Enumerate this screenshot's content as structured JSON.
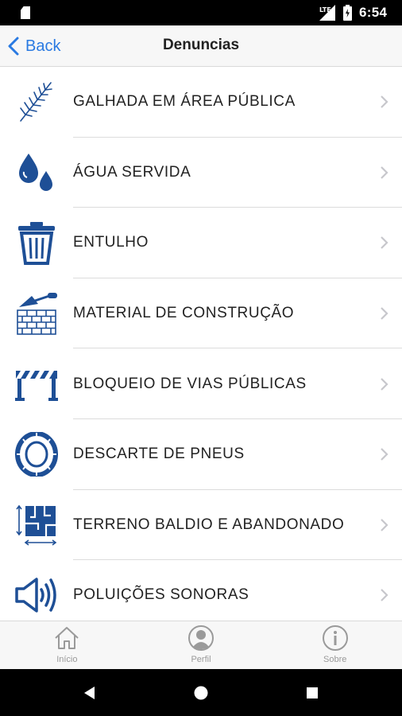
{
  "status_bar": {
    "time": "6:54",
    "network": "LTE"
  },
  "nav": {
    "back_label": "Back",
    "title": "Denuncias"
  },
  "colors": {
    "accent": "#2a7ae2",
    "icon_blue": "#1e4f96",
    "chevron": "#c7c7cc"
  },
  "items": [
    {
      "label": "GALHADA EM ÁREA PÚBLICA",
      "icon": "branch-icon"
    },
    {
      "label": "ÁGUA SERVIDA",
      "icon": "water-drops-icon"
    },
    {
      "label": "ENTULHO",
      "icon": "trash-can-icon"
    },
    {
      "label": "MATERIAL DE CONSTRUÇÃO",
      "icon": "brick-wall-trowel-icon"
    },
    {
      "label": "BLOQUEIO DE VIAS PÚBLICAS",
      "icon": "road-barrier-icon"
    },
    {
      "label": "DESCARTE DE PNEUS",
      "icon": "tire-icon"
    },
    {
      "label": "TERRENO BALDIO E ABANDONADO",
      "icon": "floor-plan-icon"
    },
    {
      "label": "POLUIÇÕES SONORAS",
      "icon": "speaker-icon"
    }
  ],
  "tabs": [
    {
      "label": "Início",
      "icon": "home-icon"
    },
    {
      "label": "Perfil",
      "icon": "profile-icon"
    },
    {
      "label": "Sobre",
      "icon": "info-icon"
    }
  ]
}
